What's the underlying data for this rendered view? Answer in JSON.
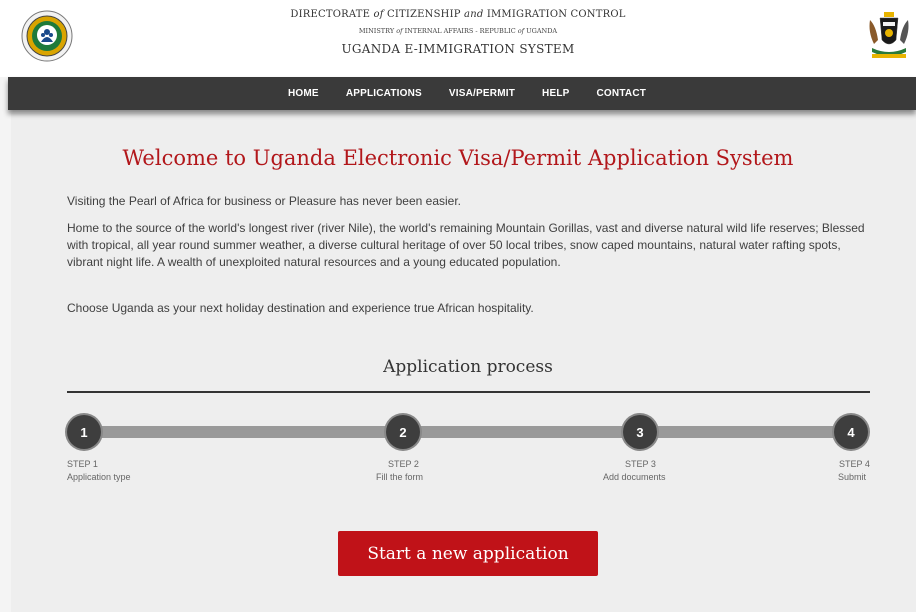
{
  "header": {
    "line1_a": "DIRECTORATE ",
    "line1_of": "of",
    "line1_b": " CITIZENSHIP ",
    "line1_and": "and",
    "line1_c": " IMMIGRATION CONTROL",
    "line2_a": "MINISTRY ",
    "line2_of": "of",
    "line2_b": " INTERNAL AFFAIRS - REPUBLIC ",
    "line2_of2": "of",
    "line2_c": " UGANDA",
    "line3": "UGANDA E-IMMIGRATION SYSTEM",
    "left_logo_icon": "immigration-crest-icon",
    "right_logo_icon": "uganda-coat-of-arms-icon"
  },
  "nav": {
    "items": [
      "HOME",
      "APPLICATIONS",
      "VISA/PERMIT",
      "HELP",
      "CONTACT"
    ]
  },
  "main": {
    "welcome": "Welcome to Uganda Electronic Visa/Permit Application System",
    "p1": "Visiting the Pearl of Africa for business or Pleasure has never been easier.",
    "p2": "Home to the source of the world's longest river (river Nile), the world's remaining Mountain Gorillas, vast and diverse natural wild life reserves; Blessed with tropical, all year round summer weather, a diverse cultural heritage of over 50 local tribes, snow caped mountains, natural water rafting spots, vibrant night life. A wealth of unexploited natural resources and a young educated population.",
    "p3": "Choose Uganda as your next holiday destination and experience true African hospitality.",
    "process_title": "Application process",
    "steps": [
      {
        "num": "1",
        "label": "STEP 1",
        "desc": "Application type"
      },
      {
        "num": "2",
        "label": "STEP 2",
        "desc": "Fill the form"
      },
      {
        "num": "3",
        "label": "STEP 3",
        "desc": "Add documents"
      },
      {
        "num": "4",
        "label": "STEP 4",
        "desc": "Submit"
      }
    ],
    "start_button": "Start a new application"
  },
  "colors": {
    "accent_red": "#c01218",
    "heading_red": "#b2171b",
    "nav_bg": "#3a3a3a"
  }
}
